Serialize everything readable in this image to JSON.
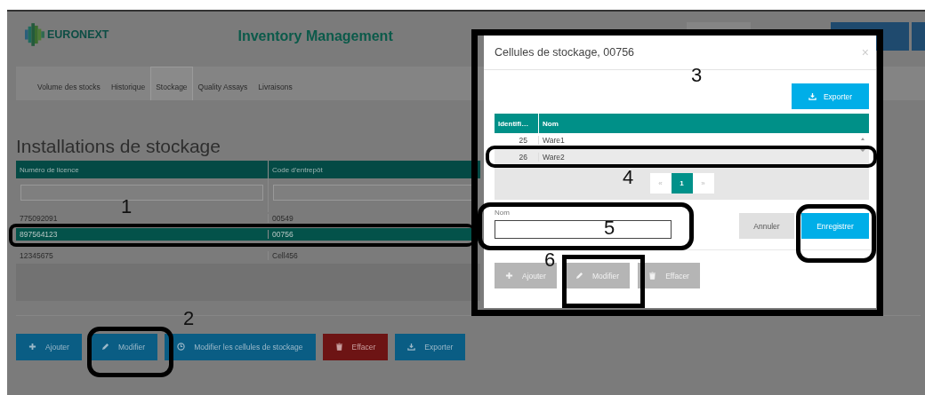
{
  "header": {
    "logo": "EURONEXT",
    "title": "Inventory Management"
  },
  "tabs": [
    {
      "label": "Volume des stocks",
      "selected": false
    },
    {
      "label": "Historique",
      "selected": false
    },
    {
      "label": "Stockage",
      "selected": true
    },
    {
      "label": "Quality Assays",
      "selected": false
    },
    {
      "label": "Livraisons",
      "selected": false
    }
  ],
  "heading": "Installations de stockage",
  "table": {
    "columns": [
      "Numéro de licence",
      "Code d'entrepôt"
    ],
    "rows": [
      {
        "cells": [
          "775092091",
          "00549"
        ],
        "selected": false
      },
      {
        "cells": [
          "897564123",
          "00756"
        ],
        "selected": true
      },
      {
        "cells": [
          "12345675",
          "Cell456"
        ],
        "selected": false
      }
    ]
  },
  "buttons": [
    {
      "label": "Ajouter",
      "kind": "add"
    },
    {
      "label": "Modifier",
      "kind": "edit"
    },
    {
      "label": "Modifier les cellules de stockage",
      "kind": "cells"
    },
    {
      "label": "Effacer",
      "kind": "delete"
    },
    {
      "label": "Exporter",
      "kind": "export"
    }
  ],
  "modal": {
    "title": "Cellules de stockage, 00756",
    "close": "×",
    "export_button": "Exporter",
    "table": {
      "columns": [
        "Identifi…",
        "Nom"
      ],
      "rows": [
        {
          "cells": [
            "25",
            "Ware1"
          ],
          "selected": false
        },
        {
          "cells": [
            "26",
            "Ware2"
          ],
          "selected": true
        }
      ]
    },
    "pagination": [
      {
        "label": "«",
        "selected": false
      },
      {
        "label": "1",
        "selected": true
      },
      {
        "label": "»",
        "selected": false
      }
    ],
    "name_field": {
      "label": "Nom"
    },
    "cancel_button": "Annuler",
    "save_button": "Enregistrer",
    "buttons": [
      {
        "label": "Ajouter",
        "kind": "add",
        "disabled": true
      },
      {
        "label": "Modifier",
        "kind": "edit",
        "disabled": true
      },
      {
        "label": "Effacer",
        "kind": "delete",
        "disabled": true
      }
    ]
  },
  "annotations": [
    {
      "label": "1"
    },
    {
      "label": "2"
    },
    {
      "label": "3"
    },
    {
      "label": "4"
    },
    {
      "label": "5"
    },
    {
      "label": "6"
    }
  ]
}
